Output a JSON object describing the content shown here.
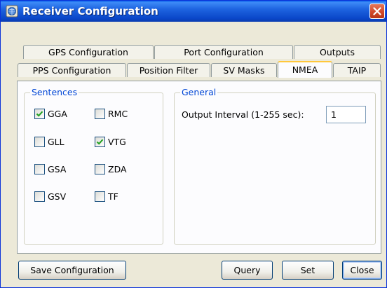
{
  "window": {
    "title": "Receiver Configuration",
    "icon": "app-globe-icon",
    "close_icon": "close-x-icon"
  },
  "tabs": {
    "row1": [
      {
        "label": "GPS Configuration"
      },
      {
        "label": "Port Configuration"
      },
      {
        "label": "Outputs"
      }
    ],
    "row2": [
      {
        "label": "PPS Configuration"
      },
      {
        "label": "Position Filter"
      },
      {
        "label": "SV Masks"
      },
      {
        "label": "NMEA",
        "active": true
      },
      {
        "label": "TAIP"
      }
    ]
  },
  "sentences": {
    "title": "Sentences",
    "items": [
      {
        "label": "GGA",
        "checked": true
      },
      {
        "label": "RMC",
        "checked": false
      },
      {
        "label": "GLL",
        "checked": false
      },
      {
        "label": "VTG",
        "checked": true
      },
      {
        "label": "GSA",
        "checked": false
      },
      {
        "label": "ZDA",
        "checked": false
      },
      {
        "label": "GSV",
        "checked": false
      },
      {
        "label": "TF",
        "checked": false
      }
    ]
  },
  "general": {
    "title": "General",
    "interval_label": "Output Interval (1-255 sec):",
    "interval_value": "1"
  },
  "buttons": {
    "save": "Save Configuration",
    "query": "Query",
    "set": "Set",
    "close": "Close"
  },
  "colors": {
    "titlebar": "#0A46C8",
    "group_title": "#0046D5",
    "active_tab_accent": "#FFC83C",
    "check": "#21A121"
  }
}
